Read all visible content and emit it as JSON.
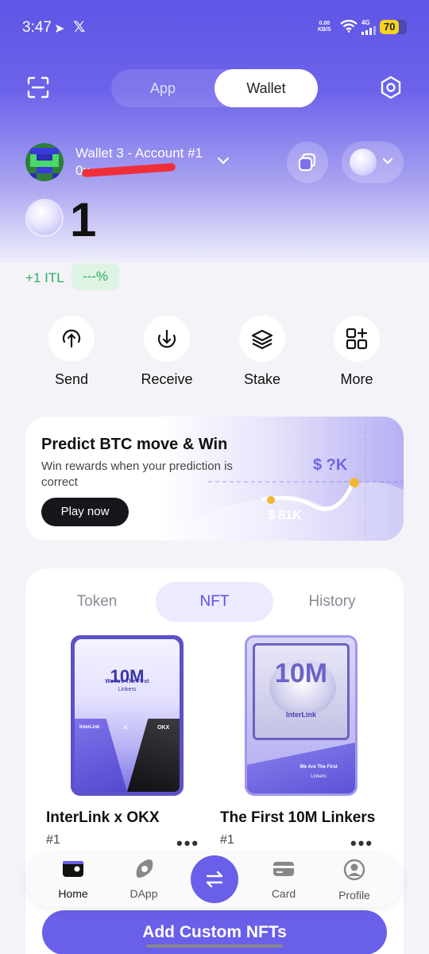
{
  "status_bar": {
    "time": "3:47",
    "net_speed_value": "0.00",
    "net_speed_unit": "KB/S",
    "signal": "4G",
    "battery": "70",
    "battery_level": 0.7
  },
  "header": {
    "tabs": [
      {
        "label": "App"
      },
      {
        "label": "Wallet"
      }
    ],
    "selected_tab": "Wallet"
  },
  "account": {
    "name": "Wallet 3 - Account #1",
    "address_prefix": "0x"
  },
  "balance": {
    "amount": "1",
    "change_amount": "+1 ITL",
    "change_percent": "---%"
  },
  "actions": [
    {
      "label": "Send",
      "icon": "send-icon"
    },
    {
      "label": "Receive",
      "icon": "receive-icon"
    },
    {
      "label": "Stake",
      "icon": "stake-icon"
    },
    {
      "label": "More",
      "icon": "more-icon"
    }
  ],
  "promo": {
    "title": "Predict BTC move & Win",
    "subtitle": "Win rewards when your prediction is correct",
    "button": "Play now",
    "target_label": "$ ?K",
    "current_label": "$ 81K"
  },
  "asset_tabs": {
    "items": [
      {
        "label": "Token"
      },
      {
        "label": "NFT"
      },
      {
        "label": "History"
      }
    ],
    "selected": "NFT"
  },
  "nfts": [
    {
      "name": "InterLink x OKX",
      "number": "#1",
      "art_top": "We Are The First",
      "art_big": "10M",
      "art_small": "Linkers",
      "brand_left": "InterLink",
      "brand_right": "OKX"
    },
    {
      "name": "The First 10M Linkers",
      "number": "#1",
      "art_top": "We Are The First",
      "art_big": "10M",
      "art_small": "Linkers",
      "brand_left": "InterLink"
    }
  ],
  "add_button": "Add Custom NFTs",
  "bottom_nav": [
    {
      "label": "Home",
      "icon": "wallet-icon"
    },
    {
      "label": "DApp",
      "icon": "dapp-icon"
    },
    {
      "label": "Card",
      "icon": "card-icon"
    },
    {
      "label": "Profile",
      "icon": "profile-icon"
    }
  ],
  "colors": {
    "accent": "#6a5fe8",
    "positive": "#26b35f"
  }
}
